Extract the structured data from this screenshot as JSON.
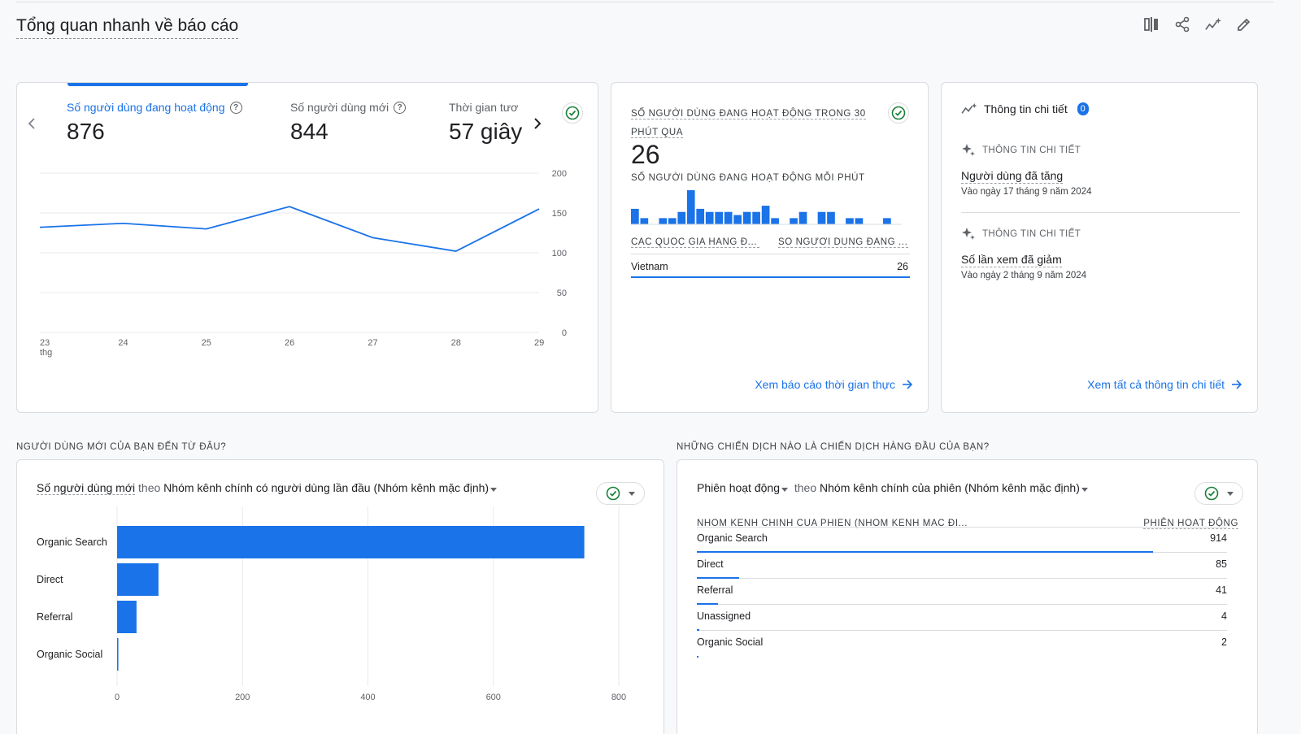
{
  "page": {
    "title": "Tổng quan nhanh về báo cáo"
  },
  "toolbar": {
    "icons": [
      "compare-icon",
      "share-icon",
      "insights-icon",
      "edit-icon"
    ]
  },
  "overview": {
    "metrics": [
      {
        "label": "Số người dùng đang hoạt động",
        "value": "876",
        "active": true
      },
      {
        "label": "Số người dùng mới",
        "value": "844",
        "active": false
      },
      {
        "label": "Thời gian tươ",
        "value": "57 giây",
        "active": false
      }
    ],
    "chart_data": {
      "type": "line",
      "x": [
        "23",
        "24",
        "25",
        "26",
        "27",
        "28",
        "29"
      ],
      "x_sub_label": "thg",
      "series": [
        {
          "values": [
            132,
            137,
            130,
            158,
            119,
            102,
            155
          ]
        }
      ],
      "ylim": [
        0,
        200
      ],
      "yticks": [
        0,
        50,
        100,
        150,
        200
      ],
      "grid": true,
      "color": "#1a73e8"
    }
  },
  "realtime": {
    "title": "SỐ NGƯỜI DÙNG ĐANG HOẠT ĐỘNG TRONG 30 PHÚT QUA",
    "value": "26",
    "subtitle": "SỐ NGƯỜI DÙNG ĐANG HOẠT ĐỘNG MỖI PHÚT",
    "minute_bars": [
      5,
      2,
      0,
      2,
      2,
      4,
      11,
      5,
      4,
      4,
      4,
      3,
      4,
      4,
      6,
      2,
      0,
      2,
      4,
      0,
      4,
      4,
      0,
      2,
      2,
      0,
      0,
      2,
      0
    ],
    "col1": "CÁC QUỐC GIA HÀNG Đ...",
    "col2": "SỐ NGƯỜI DÙNG ĐANG ...",
    "rows": [
      {
        "name": "Vietnam",
        "value": "26"
      }
    ],
    "link": "Xem báo cáo thời gian thực"
  },
  "insights": {
    "title": "Thông tin chi tiết",
    "count": "0",
    "items": [
      {
        "label": "THÔNG TIN CHI TIẾT",
        "title": "Người dùng đã tăng",
        "date": "Vào ngày 17 tháng 9 năm 2024"
      },
      {
        "label": "THÔNG TIN CHI TIẾT",
        "title": "Số lần xem đã giảm",
        "date": "Vào ngày 2 tháng 9 năm 2024"
      }
    ],
    "link": "Xem tất cả thông tin chi tiết"
  },
  "new_users": {
    "section_title": "NGƯỜI DÙNG MỚI CỦA BẠN ĐẾN TỪ ĐÂU?",
    "metric": "Số người dùng mới",
    "by": "theo",
    "dimension": "Nhóm kênh chính có người dùng lần đầu (Nhóm kênh mặc định)",
    "chart_data": {
      "type": "bar",
      "orientation": "horizontal",
      "categories": [
        "Organic Search",
        "Direct",
        "Referral",
        "Organic Social"
      ],
      "values": [
        745,
        66,
        31,
        2
      ],
      "xlim": [
        0,
        800
      ],
      "xticks": [
        0,
        200,
        400,
        600,
        800
      ],
      "grid": true,
      "color": "#1a73e8"
    }
  },
  "campaigns": {
    "section_title": "NHỮNG CHIẾN DỊCH NÀO LÀ CHIẾN DỊCH HÀNG ĐẦU CỦA BẠN?",
    "metric": "Phiên hoạt động",
    "by": "theo",
    "dimension": "Nhóm kênh chính của phiên (Nhóm kênh mặc định)",
    "col1": "NHÓM KÊNH CHÍNH CỦA PHIÊN (NHÓM KÊNH MẶC ĐỊ...",
    "col2": "PHIÊN HOẠT ĐỘNG",
    "rows": [
      {
        "name": "Organic Search",
        "value": "914",
        "share": 0.86
      },
      {
        "name": "Direct",
        "value": "85",
        "share": 0.08
      },
      {
        "name": "Referral",
        "value": "41",
        "share": 0.04
      },
      {
        "name": "Unassigned",
        "value": "4",
        "share": 0.004
      },
      {
        "name": "Organic Social",
        "value": "2",
        "share": 0.002
      }
    ]
  }
}
